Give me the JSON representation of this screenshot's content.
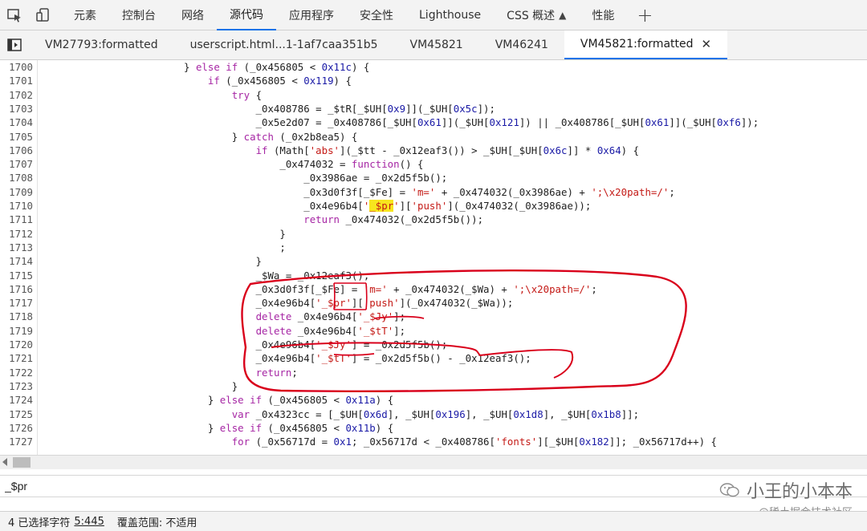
{
  "topbar": {
    "tabs": [
      "元素",
      "控制台",
      "网络",
      "源代码",
      "应用程序",
      "安全性",
      "Lighthouse",
      "CSS 概述",
      "性能"
    ],
    "active": "源代码"
  },
  "file_tabs": {
    "items": [
      "VM27793:formatted",
      "userscript.html...1-1af7caa351b5",
      "VM45821",
      "VM46241",
      "VM45821:formatted"
    ],
    "active": "VM45821:formatted"
  },
  "editor": {
    "lines": [
      {
        "n": "1700",
        "code": "                        } else if (_0x456805 < 0x11c) {"
      },
      {
        "n": "1701",
        "code": "                            if (_0x456805 < 0x119) {"
      },
      {
        "n": "1702",
        "code": "                                try {"
      },
      {
        "n": "1703",
        "code": "                                    _0x408786 = _$tR[_$UH[0x9]](_$UH[0x5c]);"
      },
      {
        "n": "1704",
        "code": "                                    _0x5e2d07 = _0x408786[_$UH[0x61]](_$UH[0x121]) || _0x408786[_$UH[0x61]](_$UH[0xf6]);"
      },
      {
        "n": "1705",
        "code": "                                } catch (_0x2b8ea5) {"
      },
      {
        "n": "1706",
        "code": "                                    if (Math['abs'](_$tt - _0x12eaf3()) > _$UH[_$UH[0x6c]] * 0x64) {"
      },
      {
        "n": "1707",
        "code": "                                        _0x474032 = function() {"
      },
      {
        "n": "1708",
        "code": "                                            _0x3986ae = _0x2d5f5b();"
      },
      {
        "n": "1709",
        "code": "                                            _0x3d0f3f[_$Fe] = 'm=' + _0x474032(_0x3986ae) + ';\\x20path=/';"
      },
      {
        "n": "1710",
        "code": "                                            _0x4e96b4['_$pr']['push'](_0x474032(_0x3986ae));"
      },
      {
        "n": "1711",
        "code": "                                            return _0x474032(_0x2d5f5b());"
      },
      {
        "n": "1712",
        "code": "                                        }"
      },
      {
        "n": "1713",
        "code": "                                        ;"
      },
      {
        "n": "1714",
        "code": "                                    }"
      },
      {
        "n": "1715",
        "code": "                                    _$Wa = _0x12eaf3();"
      },
      {
        "n": "1716",
        "code": "                                    _0x3d0f3f[_$Fe] = 'm=' + _0x474032(_$Wa) + ';\\x20path=/';"
      },
      {
        "n": "1717",
        "code": "                                    _0x4e96b4['_$pr']['push'](_0x474032(_$Wa));"
      },
      {
        "n": "1718",
        "code": "                                    delete _0x4e96b4['_$Jy'];"
      },
      {
        "n": "1719",
        "code": "                                    delete _0x4e96b4['_$tT'];"
      },
      {
        "n": "1720",
        "code": "                                    _0x4e96b4['_$Jy'] = _0x2d5f5b();"
      },
      {
        "n": "1721",
        "code": "                                    _0x4e96b4['_$tT'] = _0x2d5f5b() - _0x12eaf3();"
      },
      {
        "n": "1722",
        "code": "                                    return;"
      },
      {
        "n": "1723",
        "code": "                                }"
      },
      {
        "n": "1724",
        "code": "                            } else if (_0x456805 < 0x11a) {"
      },
      {
        "n": "1725",
        "code": "                                var _0x4323cc = [_$UH[0x6d], _$UH[0x196], _$UH[0x1d8], _$UH[0x1b8]];"
      },
      {
        "n": "1726",
        "code": "                            } else if (_0x456805 < 0x11b) {"
      },
      {
        "n": "1727",
        "code": "                                for (_0x56717d = 0x1; _0x56717d < _0x408786['fonts'][_$UH[0x182]]; _0x56717d++) {"
      }
    ],
    "highlight_term": "_$pr"
  },
  "search": {
    "value": "_$pr"
  },
  "watermark": {
    "line1": "小王的小本本",
    "line2": "@稀土掘金技术社区"
  },
  "status": {
    "selected": "4 已选择字符",
    "position": "5:445",
    "coverage": "覆盖范围: 不适用"
  },
  "colors": {
    "accent": "#1a73e8",
    "highlight": "#f7e51e",
    "annotation": "#d9001b"
  }
}
